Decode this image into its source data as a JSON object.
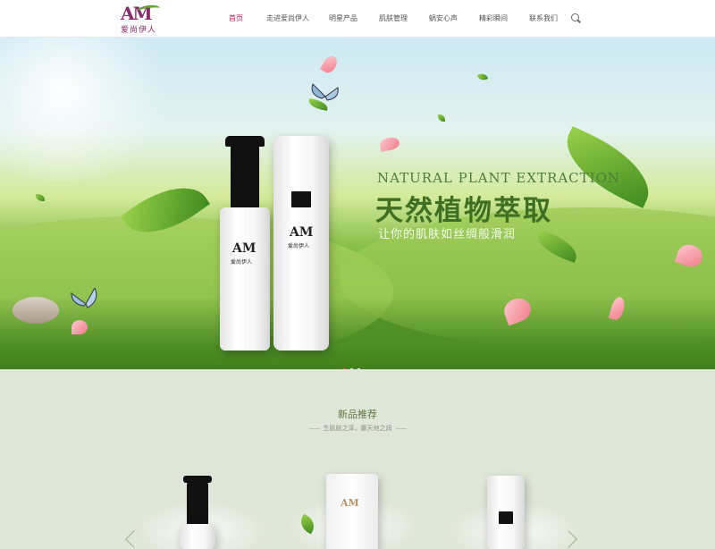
{
  "header": {
    "logo": {
      "mark": "AM",
      "text": "爱尚伊人"
    },
    "nav": [
      {
        "label": "首页",
        "active": true
      },
      {
        "label": "走进爱尚伊人",
        "active": false
      },
      {
        "label": "明星产品",
        "active": false
      },
      {
        "label": "肌肤管理",
        "active": false
      },
      {
        "label": "蜗安心声",
        "active": false
      },
      {
        "label": "精彩瞬间",
        "active": false
      },
      {
        "label": "联系我们",
        "active": false
      }
    ],
    "search_icon": "search-icon"
  },
  "banner": {
    "title_en": "NATURAL PLANT EXTRACTION",
    "title_cn": "天然植物萃取",
    "subtitle": "让你的肌肤如丝绸般滑润",
    "product_brand_mark": "AM",
    "product_brand_text": "爱尚伊人",
    "slides_total": 3,
    "slide_active": 1
  },
  "new_products": {
    "title": "新品推荐",
    "subtitle": "生肌肤之泽，赢天地之润"
  },
  "colors": {
    "accent": "#c2185b",
    "brand": "#8a2a6e",
    "leaf_green": "#6aa03c",
    "section_bg": "#dfe7d8"
  }
}
